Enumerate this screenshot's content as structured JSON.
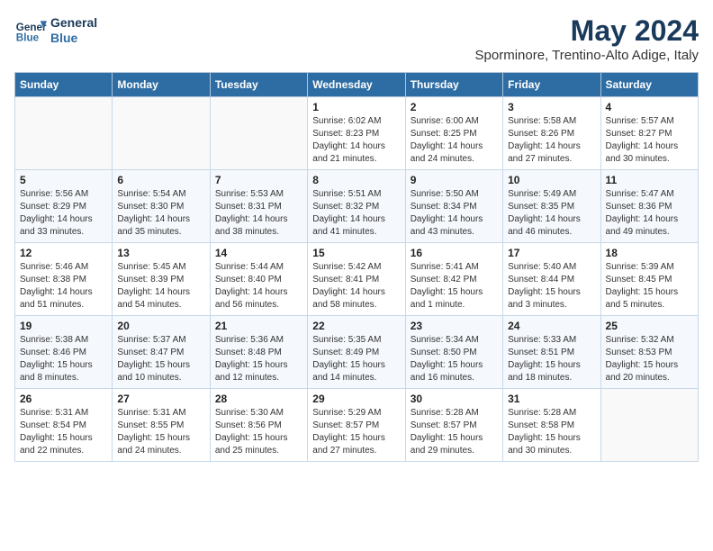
{
  "header": {
    "logo_line1": "General",
    "logo_line2": "Blue",
    "month_year": "May 2024",
    "location": "Sporminore, Trentino-Alto Adige, Italy"
  },
  "weekdays": [
    "Sunday",
    "Monday",
    "Tuesday",
    "Wednesday",
    "Thursday",
    "Friday",
    "Saturday"
  ],
  "weeks": [
    [
      {
        "day": "",
        "info": ""
      },
      {
        "day": "",
        "info": ""
      },
      {
        "day": "",
        "info": ""
      },
      {
        "day": "1",
        "info": "Sunrise: 6:02 AM\nSunset: 8:23 PM\nDaylight: 14 hours and 21 minutes."
      },
      {
        "day": "2",
        "info": "Sunrise: 6:00 AM\nSunset: 8:25 PM\nDaylight: 14 hours and 24 minutes."
      },
      {
        "day": "3",
        "info": "Sunrise: 5:58 AM\nSunset: 8:26 PM\nDaylight: 14 hours and 27 minutes."
      },
      {
        "day": "4",
        "info": "Sunrise: 5:57 AM\nSunset: 8:27 PM\nDaylight: 14 hours and 30 minutes."
      }
    ],
    [
      {
        "day": "5",
        "info": "Sunrise: 5:56 AM\nSunset: 8:29 PM\nDaylight: 14 hours and 33 minutes."
      },
      {
        "day": "6",
        "info": "Sunrise: 5:54 AM\nSunset: 8:30 PM\nDaylight: 14 hours and 35 minutes."
      },
      {
        "day": "7",
        "info": "Sunrise: 5:53 AM\nSunset: 8:31 PM\nDaylight: 14 hours and 38 minutes."
      },
      {
        "day": "8",
        "info": "Sunrise: 5:51 AM\nSunset: 8:32 PM\nDaylight: 14 hours and 41 minutes."
      },
      {
        "day": "9",
        "info": "Sunrise: 5:50 AM\nSunset: 8:34 PM\nDaylight: 14 hours and 43 minutes."
      },
      {
        "day": "10",
        "info": "Sunrise: 5:49 AM\nSunset: 8:35 PM\nDaylight: 14 hours and 46 minutes."
      },
      {
        "day": "11",
        "info": "Sunrise: 5:47 AM\nSunset: 8:36 PM\nDaylight: 14 hours and 49 minutes."
      }
    ],
    [
      {
        "day": "12",
        "info": "Sunrise: 5:46 AM\nSunset: 8:38 PM\nDaylight: 14 hours and 51 minutes."
      },
      {
        "day": "13",
        "info": "Sunrise: 5:45 AM\nSunset: 8:39 PM\nDaylight: 14 hours and 54 minutes."
      },
      {
        "day": "14",
        "info": "Sunrise: 5:44 AM\nSunset: 8:40 PM\nDaylight: 14 hours and 56 minutes."
      },
      {
        "day": "15",
        "info": "Sunrise: 5:42 AM\nSunset: 8:41 PM\nDaylight: 14 hours and 58 minutes."
      },
      {
        "day": "16",
        "info": "Sunrise: 5:41 AM\nSunset: 8:42 PM\nDaylight: 15 hours and 1 minute."
      },
      {
        "day": "17",
        "info": "Sunrise: 5:40 AM\nSunset: 8:44 PM\nDaylight: 15 hours and 3 minutes."
      },
      {
        "day": "18",
        "info": "Sunrise: 5:39 AM\nSunset: 8:45 PM\nDaylight: 15 hours and 5 minutes."
      }
    ],
    [
      {
        "day": "19",
        "info": "Sunrise: 5:38 AM\nSunset: 8:46 PM\nDaylight: 15 hours and 8 minutes."
      },
      {
        "day": "20",
        "info": "Sunrise: 5:37 AM\nSunset: 8:47 PM\nDaylight: 15 hours and 10 minutes."
      },
      {
        "day": "21",
        "info": "Sunrise: 5:36 AM\nSunset: 8:48 PM\nDaylight: 15 hours and 12 minutes."
      },
      {
        "day": "22",
        "info": "Sunrise: 5:35 AM\nSunset: 8:49 PM\nDaylight: 15 hours and 14 minutes."
      },
      {
        "day": "23",
        "info": "Sunrise: 5:34 AM\nSunset: 8:50 PM\nDaylight: 15 hours and 16 minutes."
      },
      {
        "day": "24",
        "info": "Sunrise: 5:33 AM\nSunset: 8:51 PM\nDaylight: 15 hours and 18 minutes."
      },
      {
        "day": "25",
        "info": "Sunrise: 5:32 AM\nSunset: 8:53 PM\nDaylight: 15 hours and 20 minutes."
      }
    ],
    [
      {
        "day": "26",
        "info": "Sunrise: 5:31 AM\nSunset: 8:54 PM\nDaylight: 15 hours and 22 minutes."
      },
      {
        "day": "27",
        "info": "Sunrise: 5:31 AM\nSunset: 8:55 PM\nDaylight: 15 hours and 24 minutes."
      },
      {
        "day": "28",
        "info": "Sunrise: 5:30 AM\nSunset: 8:56 PM\nDaylight: 15 hours and 25 minutes."
      },
      {
        "day": "29",
        "info": "Sunrise: 5:29 AM\nSunset: 8:57 PM\nDaylight: 15 hours and 27 minutes."
      },
      {
        "day": "30",
        "info": "Sunrise: 5:28 AM\nSunset: 8:57 PM\nDaylight: 15 hours and 29 minutes."
      },
      {
        "day": "31",
        "info": "Sunrise: 5:28 AM\nSunset: 8:58 PM\nDaylight: 15 hours and 30 minutes."
      },
      {
        "day": "",
        "info": ""
      }
    ]
  ]
}
